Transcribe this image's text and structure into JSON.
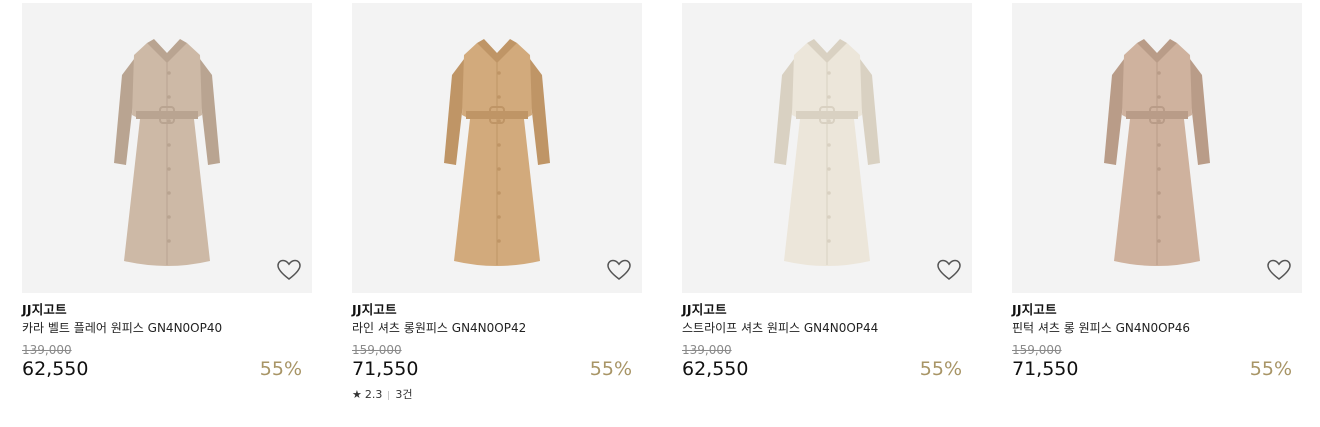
{
  "products": [
    {
      "brand": "JJ지고트",
      "name": "카라 벨트 플레어 원피스 GN4N0OP40",
      "original_price": "139,000",
      "price": "62,550",
      "discount": "55%",
      "dress_color": "#cdb9a6",
      "dress_shade": "#b9a491",
      "wishlist_icon": "heart-outline-icon"
    },
    {
      "brand": "JJ지고트",
      "name": "라인 셔츠 롱원피스 GN4N0OP42",
      "original_price": "159,000",
      "price": "71,550",
      "discount": "55%",
      "rating": "2.3",
      "review_count": "3건",
      "dress_color": "#d2aa7c",
      "dress_shade": "#bf9566",
      "wishlist_icon": "heart-outline-icon"
    },
    {
      "brand": "JJ지고트",
      "name": "스트라이프 셔츠 원피스 GN4N0OP44",
      "original_price": "139,000",
      "price": "62,550",
      "discount": "55%",
      "dress_color": "#ece6da",
      "dress_shade": "#d9d1c2",
      "wishlist_icon": "heart-outline-icon"
    },
    {
      "brand": "JJ지고트",
      "name": "핀턱 셔츠 롱 원피스 GN4N0OP46",
      "original_price": "159,000",
      "price": "71,550",
      "discount": "55%",
      "dress_color": "#cfb29e",
      "dress_shade": "#b99c88",
      "wishlist_icon": "heart-outline-icon"
    }
  ],
  "colors": {
    "discount": "#a89566",
    "thumb_bg": "#f3f3f3",
    "strike": "#8a8a8a"
  }
}
